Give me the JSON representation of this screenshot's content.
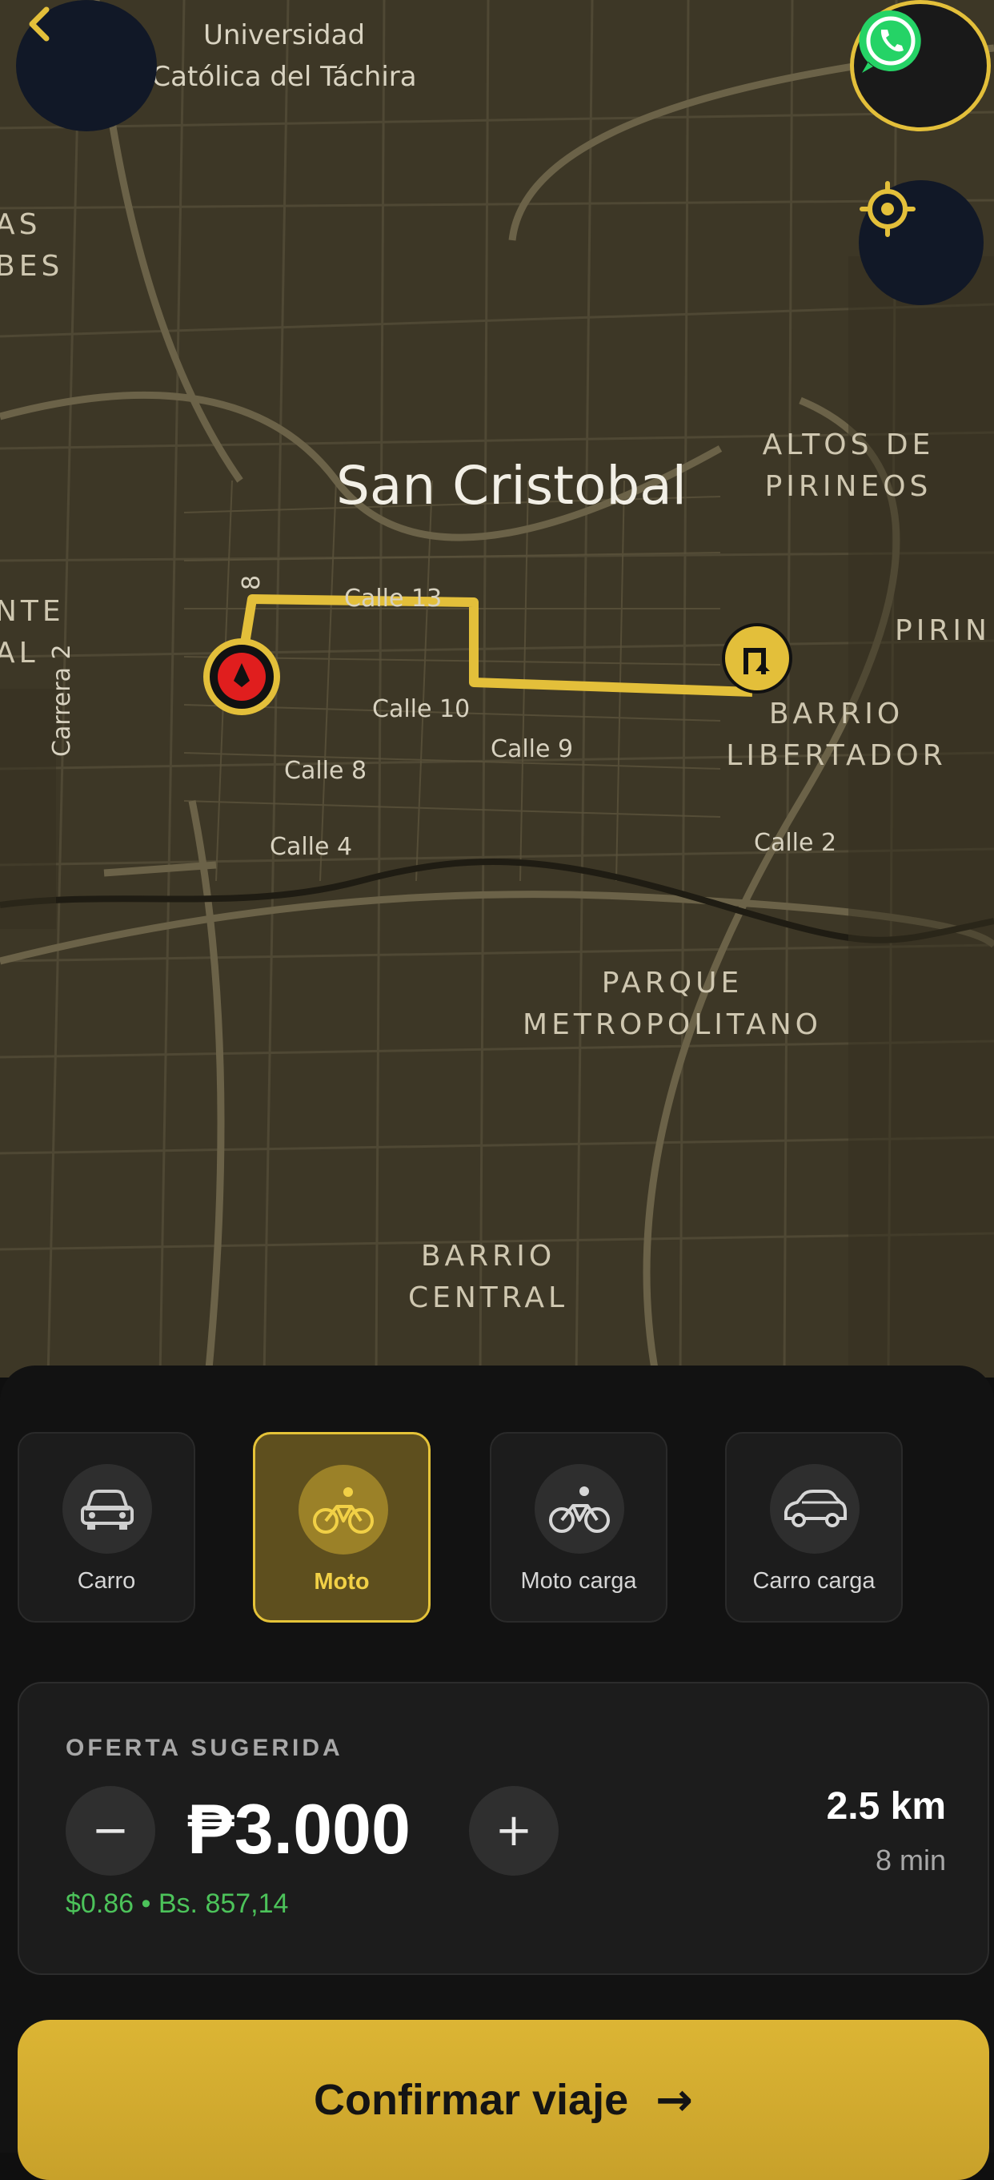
{
  "map": {
    "city_label": "San Cristobal",
    "districts": [
      {
        "id": "universidad",
        "lines": [
          "Universidad",
          "Católica del Táchira"
        ]
      },
      {
        "id": "altos",
        "lines": [
          "ALTOS DE",
          "PIRINEOS"
        ]
      },
      {
        "id": "pirin",
        "lines": [
          "PIRIN"
        ]
      },
      {
        "id": "barrio-libertador",
        "lines": [
          "BARRIO",
          "LIBERTADOR"
        ]
      },
      {
        "id": "parque",
        "lines": [
          "PARQUE",
          "METROPOLITANO"
        ]
      },
      {
        "id": "barrio-central",
        "lines": [
          "BARRIO",
          "CENTRAL"
        ]
      },
      {
        "id": "left-as",
        "lines": [
          "AS",
          "BES"
        ]
      },
      {
        "id": "left-nte",
        "lines": [
          "NTE",
          "AL"
        ]
      }
    ],
    "streets": [
      "Calle 13",
      "Calle 10",
      "Calle 9",
      "Calle 8",
      "Calle 4",
      "Calle 2",
      "Carrera 2",
      "8"
    ],
    "route_color": "#e3bf3a",
    "origin_marker_color": "#e01e1e"
  },
  "controls": {
    "back_icon": "chevron-left-icon",
    "whatsapp_icon": "whatsapp-icon",
    "locate_icon": "crosshair-icon"
  },
  "vehicles": [
    {
      "label": "Carro",
      "icon": "car-icon",
      "selected": false
    },
    {
      "label": "Moto",
      "icon": "bicycle-icon",
      "selected": true
    },
    {
      "label": "Moto carga",
      "icon": "bicycle-icon",
      "selected": false
    },
    {
      "label": "Carro carga",
      "icon": "car-icon",
      "selected": false
    }
  ],
  "offer": {
    "title": "OFERTA SUGERIDA",
    "price": "₱3.000",
    "conversion": "$0.86 • Bs. 857,14",
    "distance": "2.5 km",
    "duration": "8 min",
    "decrement": "−",
    "increment": "+"
  },
  "confirm": {
    "label": "Confirmar viaje",
    "arrow": "→"
  },
  "colors": {
    "accent": "#e3bf3a",
    "conversion_green": "#4cc35a",
    "whatsapp": "#25d366"
  }
}
